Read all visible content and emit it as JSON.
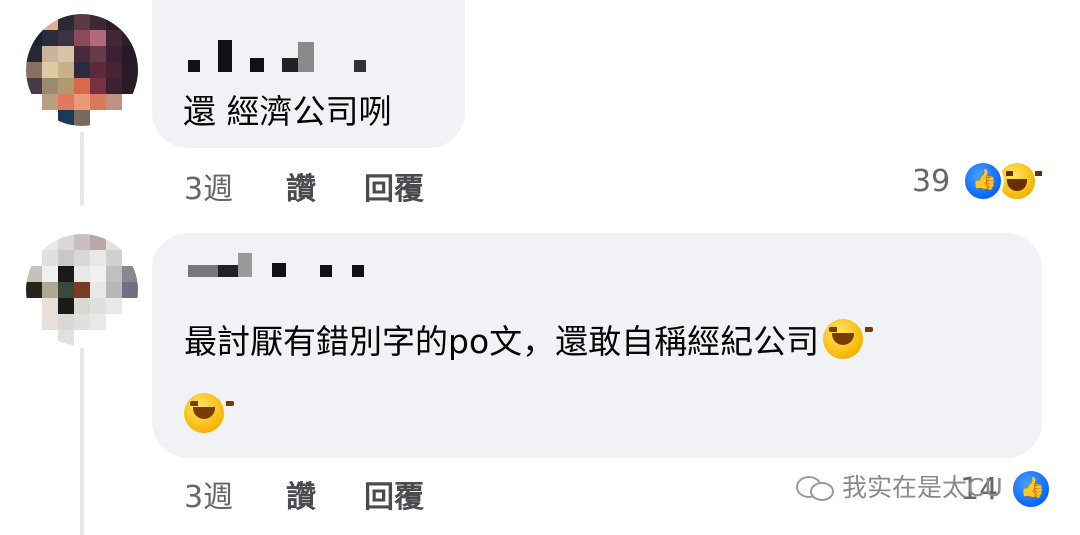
{
  "comments": [
    {
      "text": "還 經濟公司咧",
      "time": "3週",
      "like_label": "讚",
      "reply_label": "回覆",
      "reaction_count": "39",
      "reactions": [
        "like-icon",
        "haha-icon"
      ]
    },
    {
      "text": "最討厭有錯別字的po文，還敢自稱經紀公司",
      "emoji": "rolling-on-floor-laughing-icon",
      "time": "3週",
      "like_label": "讚",
      "reply_label": "回覆",
      "reaction_count": "14",
      "reactions": [
        "like-icon"
      ]
    }
  ],
  "watermark": {
    "text": "我实在是太CU",
    "icon": "wechat-icon"
  },
  "colors": {
    "bubble": "#f0f2f5",
    "meta_text": "#65676b",
    "like_blue": "#0866ff"
  }
}
